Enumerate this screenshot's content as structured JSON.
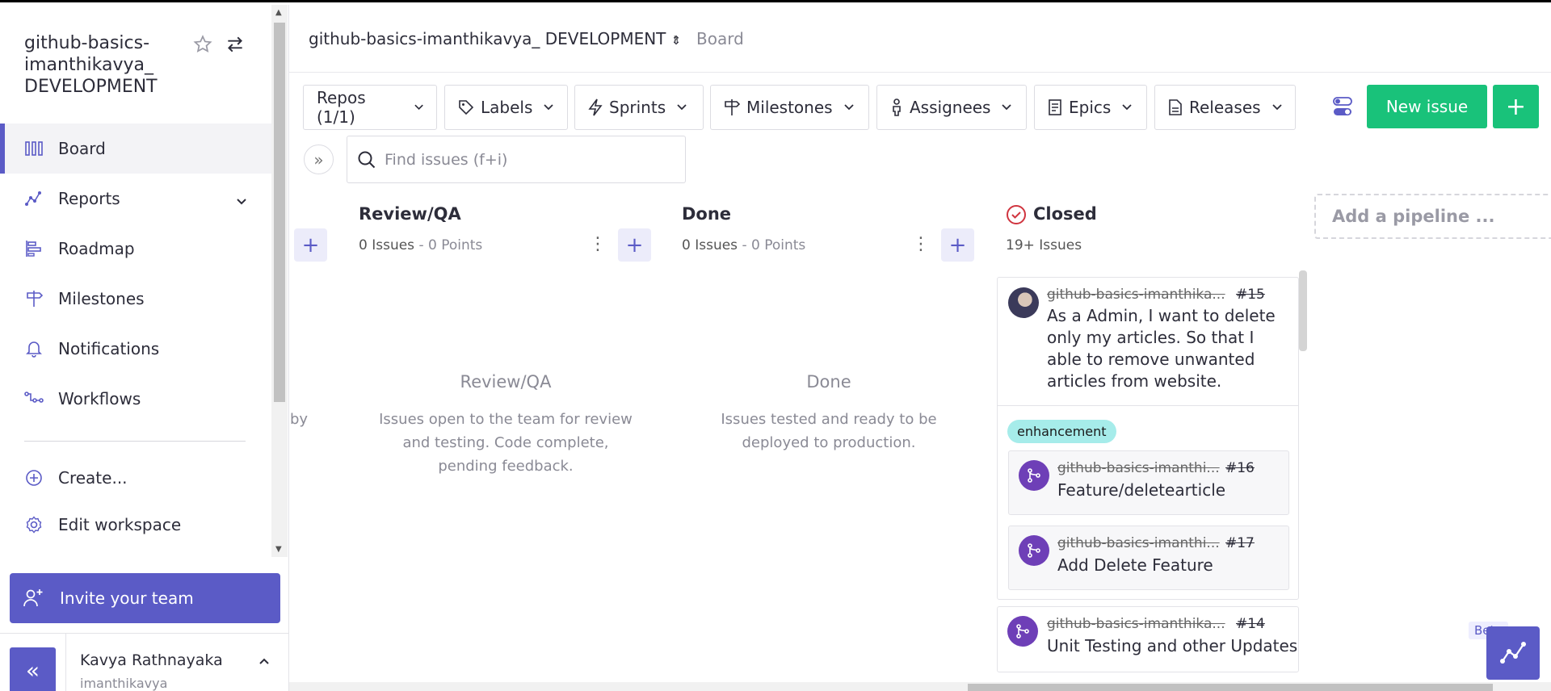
{
  "workspace": {
    "name": "github-basics-imanthikavya_ DEVELOPMENT"
  },
  "sidebar": {
    "items": [
      {
        "label": "Board",
        "icon": "board-icon",
        "active": true
      },
      {
        "label": "Reports",
        "icon": "reports-icon"
      },
      {
        "label": "Roadmap",
        "icon": "roadmap-icon"
      },
      {
        "label": "Milestones",
        "icon": "milestone-icon"
      },
      {
        "label": "Notifications",
        "icon": "bell-icon"
      },
      {
        "label": "Workflows",
        "icon": "workflow-icon"
      }
    ],
    "actions": [
      {
        "label": "Create...",
        "icon": "plus-circle-icon"
      },
      {
        "label": "Edit workspace",
        "icon": "gear-icon"
      }
    ],
    "invite_label": "Invite your team",
    "collapse_label": "«",
    "user": {
      "name": "Kavya Rathnayaka",
      "handle": "imanthikavya"
    }
  },
  "breadcrumb": {
    "workspace": "github-basics-imanthikavya_ DEVELOPMENT",
    "current": "Board"
  },
  "filters": [
    {
      "label": "Repos (1/1)"
    },
    {
      "label": "Labels",
      "icon": "tag-icon"
    },
    {
      "label": "Sprints",
      "icon": "bolt-icon"
    },
    {
      "label": "Milestones",
      "icon": "milestone-icon"
    },
    {
      "label": "Assignees",
      "icon": "person-icon"
    },
    {
      "label": "Epics",
      "icon": "epic-icon"
    },
    {
      "label": "Releases",
      "icon": "release-icon"
    }
  ],
  "new_issue_label": "New issue",
  "search": {
    "placeholder": "Find issues (f+i)"
  },
  "board": {
    "partial_text": "by",
    "columns": [
      {
        "title": "Review/QA",
        "issues": "0 Issues",
        "points": " - 0 Points",
        "empty_title": "Review/QA",
        "empty_desc": "Issues open to the team for review and testing. Code complete, pending feedback."
      },
      {
        "title": "Done",
        "issues": "0 Issues",
        "points": " - 0 Points",
        "empty_title": "Done",
        "empty_desc": "Issues tested and ready to be deployed to production."
      },
      {
        "title": "Closed",
        "issues": "19+ Issues"
      }
    ],
    "add_pipeline": "Add a pipeline ...",
    "cards": [
      {
        "repo": "github-basics-imanthika...",
        "number": "#15",
        "title": "As a Admin, I want to delete only my articles. So that I able to remove unwanted articles from website.",
        "label": "enhancement",
        "linked": [
          {
            "repo": "github-basics-imanthi...",
            "number": "#16",
            "title": "Feature/deletearticle"
          },
          {
            "repo": "github-basics-imanthi...",
            "number": "#17",
            "title": "Add Delete Feature"
          }
        ]
      },
      {
        "repo": "github-basics-imanthika...",
        "number": "#14",
        "title": "Unit Testing and other Updates"
      }
    ]
  },
  "beta_label": "Beta",
  "colors": {
    "accent": "#5b5bc6",
    "green": "#19c27a",
    "label": "#a6ecea",
    "pr": "#6e3fb7",
    "closed": "#d0343f"
  }
}
